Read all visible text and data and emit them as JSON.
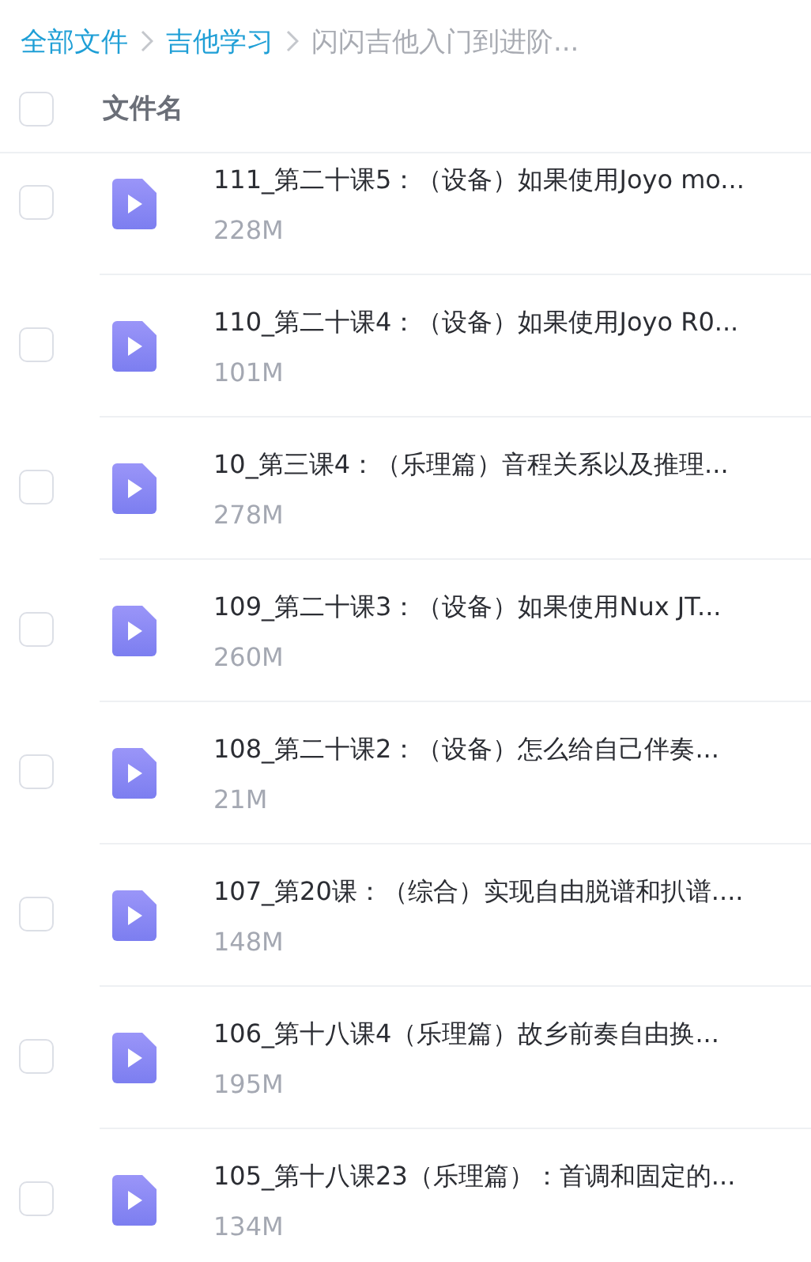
{
  "breadcrumb": [
    {
      "label": "全部文件",
      "current": false
    },
    {
      "label": "吉他学习",
      "current": false
    },
    {
      "label": "闪闪吉他入门到进阶...",
      "current": true
    }
  ],
  "table": {
    "select_all_checked": false,
    "column": "文件名",
    "rows": [
      {
        "name": "111_第二十课5：（设备）如果使用Joyo mo...",
        "size": "228M",
        "checked": false
      },
      {
        "name": "110_第二十课4：（设备）如果使用Joyo R0...",
        "size": "101M",
        "checked": false
      },
      {
        "name": "10_第三课4：（乐理篇）音程关系以及推理...",
        "size": "278M",
        "checked": false
      },
      {
        "name": "109_第二十课3：（设备）如果使用Nux JT...",
        "size": "260M",
        "checked": false
      },
      {
        "name": "108_第二十课2：（设备）怎么给自己伴奏...",
        "size": "21M",
        "checked": false
      },
      {
        "name": "107_第20课：（综合）实现自由脱谱和扒谱....",
        "size": "148M",
        "checked": false
      },
      {
        "name": "106_第十八课4（乐理篇）故乡前奏自由换...",
        "size": "195M",
        "checked": false
      },
      {
        "name": "105_第十八课23（乐理篇）：首调和固定的...",
        "size": "134M",
        "checked": false
      }
    ]
  }
}
